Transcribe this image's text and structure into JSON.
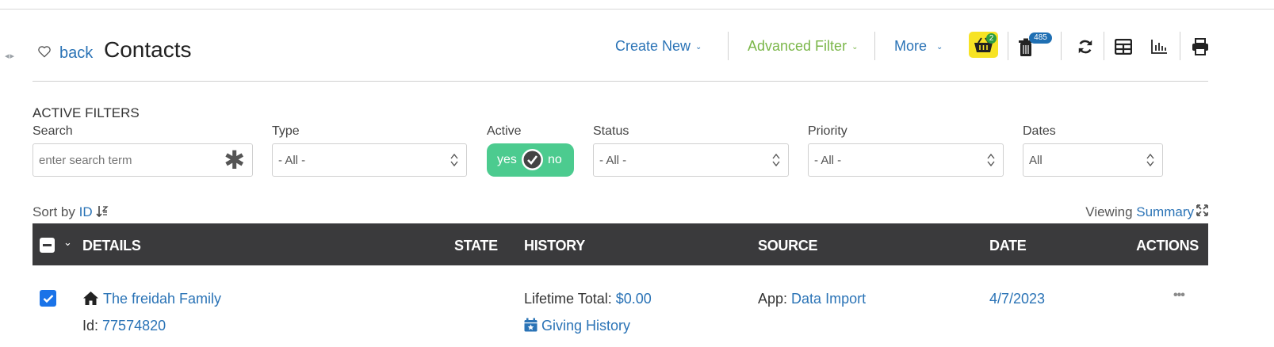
{
  "header": {
    "back_label": "back",
    "title": "Contacts",
    "create_new": "Create New",
    "advanced_filter": "Advanced Filter",
    "more": "More",
    "basket_count": "2",
    "trash_count": "485"
  },
  "filters": {
    "title": "ACTIVE FILTERS",
    "search_label": "Search",
    "search_placeholder": "enter search term",
    "type_label": "Type",
    "type_value": "- All -",
    "active_label": "Active",
    "active_yes": "yes",
    "active_no": "no",
    "status_label": "Status",
    "status_value": "- All -",
    "priority_label": "Priority",
    "priority_value": "- All -",
    "dates_label": "Dates",
    "dates_value": "All"
  },
  "sort": {
    "prefix": "Sort by",
    "field": "ID"
  },
  "view": {
    "prefix": "Viewing",
    "mode": "Summary"
  },
  "table": {
    "columns": [
      "DETAILS",
      "STATE",
      "HISTORY",
      "SOURCE",
      "DATE",
      "ACTIONS"
    ],
    "rows": [
      {
        "name": "The freidah Family",
        "id_label": "Id:",
        "id": "77574820",
        "lifetime_label": "Lifetime Total:",
        "lifetime_value": "$0.00",
        "giving_history": "Giving History",
        "source_label": "App:",
        "source_value": "Data Import",
        "date": "4/7/2023",
        "actions": "•••"
      }
    ]
  },
  "colors": {
    "link": "#2a73b6",
    "advanced_filter": "#7ab648",
    "toggle": "#4ccb8f",
    "table_header": "#3a3a3c",
    "basket_highlight": "#f7e324"
  }
}
